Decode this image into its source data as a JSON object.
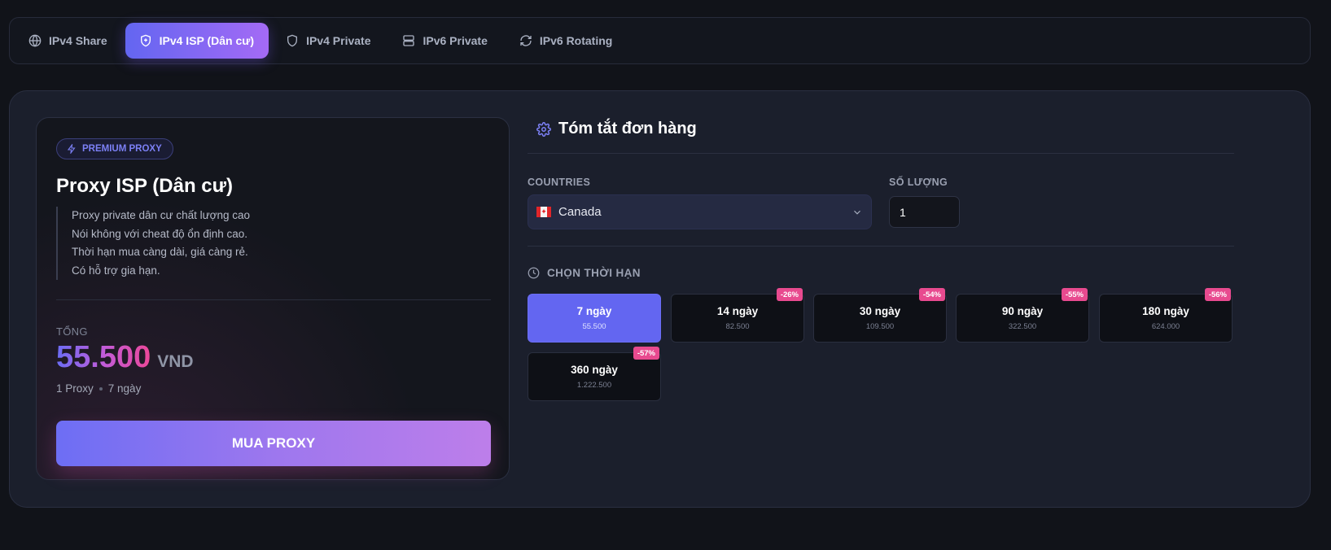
{
  "tabs": [
    {
      "label": "IPv4 Share",
      "icon": "globe-icon"
    },
    {
      "label": "IPv4 ISP (Dân cư)",
      "icon": "shield-plus-icon"
    },
    {
      "label": "IPv4 Private",
      "icon": "shield-icon"
    },
    {
      "label": "IPv6 Private",
      "icon": "server-icon"
    },
    {
      "label": "IPv6 Rotating",
      "icon": "refresh-icon"
    }
  ],
  "active_tab": "IPv4 ISP (Dân cư)",
  "product": {
    "badge": "PREMIUM PROXY",
    "title": "Proxy ISP (Dân cư)",
    "description": [
      "Proxy private dân cư chất lượng cao",
      "Nói không với cheat độ ổn định cao.",
      "Thời hạn mua càng dài, giá càng rẻ.",
      "Có hỗ trợ gia hạn."
    ],
    "total_label": "TỔNG",
    "total_amount": "55.500",
    "currency": "VND",
    "meta_quantity": "1 Proxy",
    "meta_duration": "7 ngày",
    "buy_label": "MUA PROXY"
  },
  "summary": {
    "title": "Tóm tắt đơn hàng",
    "countries_label": "COUNTRIES",
    "country": "Canada",
    "quantity_label": "SỐ LƯỢNG",
    "quantity": "1",
    "duration_label": "CHỌN THỜI HẠN"
  },
  "durations": [
    {
      "days": "7 ngày",
      "price": "55.500",
      "discount": "",
      "selected": true
    },
    {
      "days": "14 ngày",
      "price": "82.500",
      "discount": "-26%",
      "selected": false
    },
    {
      "days": "30 ngày",
      "price": "109.500",
      "discount": "-54%",
      "selected": false
    },
    {
      "days": "90 ngày",
      "price": "322.500",
      "discount": "-55%",
      "selected": false
    },
    {
      "days": "180 ngày",
      "price": "624.000",
      "discount": "-56%",
      "selected": false
    },
    {
      "days": "360 ngày",
      "price": "1.222.500",
      "discount": "-57%",
      "selected": false
    }
  ],
  "colors": {
    "accent": "#6366f1",
    "accent_gradient_end": "#a855f7",
    "discount": "#e84a8f",
    "background": "#111319",
    "panel": "#1b1f2c"
  }
}
